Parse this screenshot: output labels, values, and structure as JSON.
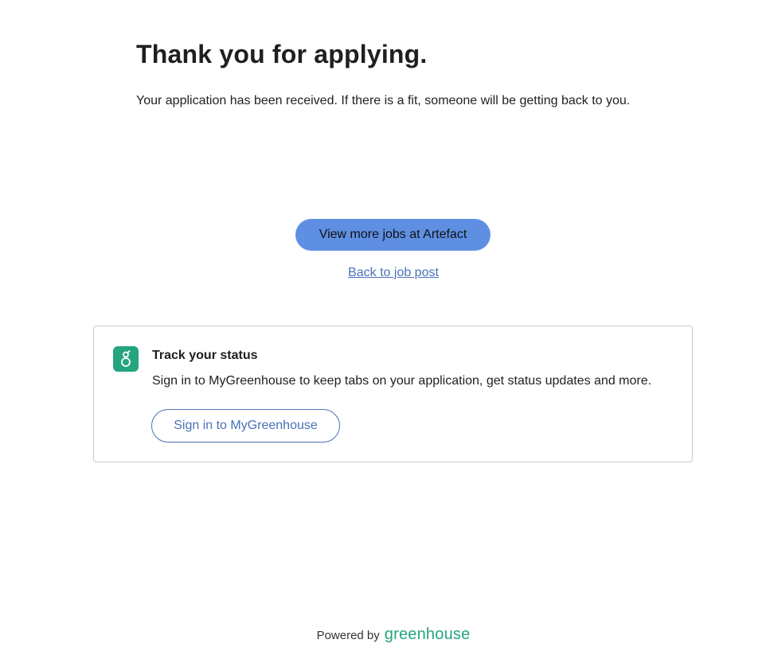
{
  "confirmation": {
    "title": "Thank you for applying.",
    "message": "Your application has been received. If there is a fit, someone will be getting back to you."
  },
  "actions": {
    "view_more_jobs_label": "View more jobs at Artefact",
    "back_link_label": "Back to job post"
  },
  "track_status": {
    "logo_icon": "greenhouse-logo-icon",
    "logo_letter": "g",
    "title": "Track your status",
    "description": "Sign in to MyGreenhouse to keep tabs on your application, get status updates and more.",
    "sign_in_label": "Sign in to MyGreenhouse"
  },
  "footer": {
    "powered_by": "Powered by",
    "brand": "greenhouse"
  },
  "colors": {
    "primary_button": "#5e8fe3",
    "link": "#4a72b8",
    "brand_green": "#24a47f",
    "card_border": "#c9c9c9"
  }
}
